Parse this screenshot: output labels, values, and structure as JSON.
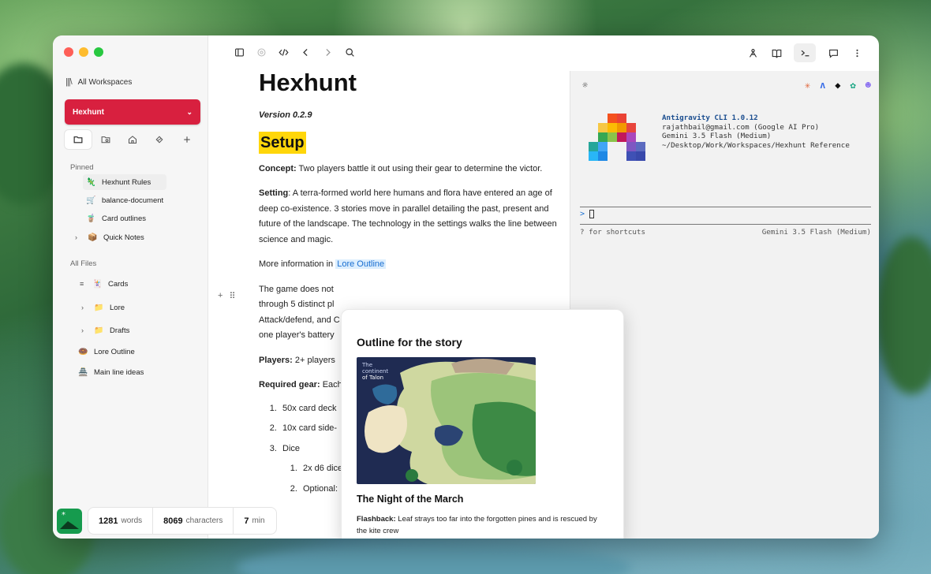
{
  "sidebar": {
    "all_workspaces": "All Workspaces",
    "workspace": "Hexhunt",
    "pinned_label": "Pinned",
    "pinned": [
      {
        "icon": "🦎",
        "label": "Hexhunt Rules"
      },
      {
        "icon": "🛒",
        "label": "balance-document"
      },
      {
        "icon": "🧋",
        "label": "Card outlines"
      },
      {
        "icon": "📦",
        "label": "Quick Notes"
      }
    ],
    "all_files_label": "All Files",
    "files": [
      {
        "icon": "🃏",
        "label": "Cards"
      },
      {
        "icon": "📁",
        "label": "Lore"
      },
      {
        "icon": "📁",
        "label": "Drafts"
      },
      {
        "icon": "🍩",
        "label": "Lore Outline"
      },
      {
        "icon": "🏯",
        "label": "Main line ideas"
      }
    ]
  },
  "status": {
    "words_value": "1281",
    "words_label": "words",
    "chars_value": "8069",
    "chars_label": "characters",
    "time_value": "7",
    "time_label": "min"
  },
  "doc": {
    "title": "Hexhunt",
    "version": "Version 0.2.9",
    "setup": "Setup",
    "concept_label": "Concept:",
    "concept_text": " Two players battle it out using their gear to determine the victor.",
    "setting_label": "Setting",
    "setting_text": ": A terra-formed world here humans and flora have entered an age of deep co-existence. 3 stories move in parallel detailing the past, present and future of the landscape. The technology in the settings walks the line between science and magic.",
    "more_info": "More information in ",
    "more_link": "Lore Outline",
    "game_line1": "The game does not",
    "game_line2": "through 5 distinct pl",
    "game_line3": "Attack/defend, and C",
    "game_line4": "one player's battery",
    "players_label": "Players:",
    "players_text": " 2+ players",
    "gear_label": "Required gear:",
    "gear_text": " Each",
    "list1": "50x card deck",
    "list2": "10x card side-",
    "list3": "Dice",
    "sub1": "2x d6 dice",
    "sub2": "Optional:"
  },
  "terminal": {
    "title": "Antigravity CLI 1.0.12",
    "account": "rajathbail@gmail.com (Google AI Pro)",
    "model": "Gemini 3.5 Flash (Medium)",
    "path": "~/Desktop/Work/Workspaces/Hexhunt Reference",
    "prompt": ">",
    "hint": "? for shortcuts",
    "model_status": "Gemini 3.5 Flash (Medium)"
  },
  "popup": {
    "title": "Outline for the story",
    "map_title_1": "The",
    "map_title_2": "continent",
    "map_title_3": "of Talon",
    "subtitle": "The Night of the March",
    "flashback_label": "Flashback:",
    "flashback_text": " Leaf strays too far into the forgotten pines and is rescued by the kite crew"
  }
}
